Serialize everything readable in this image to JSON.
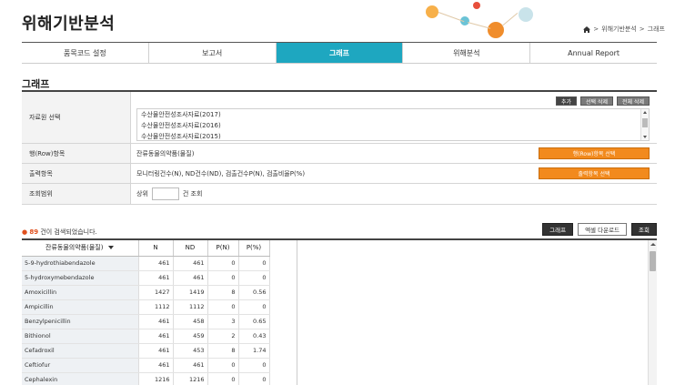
{
  "app": {
    "title": "위해기반분석"
  },
  "breadcrumb": [
    "위해기반분석",
    "그래프"
  ],
  "tabs": [
    {
      "label": "품목코드 설정",
      "active": false
    },
    {
      "label": "보고서",
      "active": false
    },
    {
      "label": "그래프",
      "active": true
    },
    {
      "label": "위해분석",
      "active": false
    },
    {
      "label": "Annual Report",
      "active": false
    }
  ],
  "section": {
    "title": "그래프"
  },
  "form": {
    "source": {
      "label": "자료원 선택",
      "buttons": [
        "추가",
        "선택 삭제",
        "전체 삭제"
      ],
      "items": [
        "수산물안전성조사자료(2017)",
        "수산물안전성조사자료(2016)",
        "수산물안전성조사자료(2015)"
      ]
    },
    "rows": {
      "label": "행(Row)항목",
      "value": "잔류동물의약품(물질)",
      "button": "행(Row)항목 선택"
    },
    "output": {
      "label": "출력항목",
      "value": "모니터링건수(N), ND건수(ND), 검출건수P(N), 검출비율P(%)",
      "button": "출력항목 선택"
    },
    "count": {
      "label": "조회범위",
      "prefix": "상위",
      "suffix": "건 조회",
      "value": ""
    }
  },
  "results": {
    "count": "89",
    "message": "건이 검색되었습니다.",
    "buttons": {
      "graph": "그래프",
      "excel": "엑셀 다운로드",
      "search": "조회"
    }
  },
  "table": {
    "columns": [
      "잔류동물의약품(물질)",
      "N",
      "ND",
      "P(N)",
      "P(%)"
    ],
    "rows": [
      [
        "5-9-hydrothiabendazole",
        "461",
        "461",
        "0",
        "0"
      ],
      [
        "5-hydroxymebendazole",
        "461",
        "461",
        "0",
        "0"
      ],
      [
        "Amoxicillin",
        "1427",
        "1419",
        "8",
        "0.56"
      ],
      [
        "Ampicillin",
        "1112",
        "1112",
        "0",
        "0"
      ],
      [
        "Benzylpenicillin",
        "461",
        "458",
        "3",
        "0.65"
      ],
      [
        "Bithionol",
        "461",
        "459",
        "2",
        "0.43"
      ],
      [
        "Cefadroxil",
        "461",
        "453",
        "8",
        "1.74"
      ],
      [
        "Ceftiofur",
        "461",
        "461",
        "0",
        "0"
      ],
      [
        "Cephalexin",
        "1216",
        "1216",
        "0",
        "0"
      ]
    ]
  },
  "colors": {
    "accent": "#1ea7c0",
    "orange": "#f28a1d",
    "highlight": "#e0501e"
  }
}
